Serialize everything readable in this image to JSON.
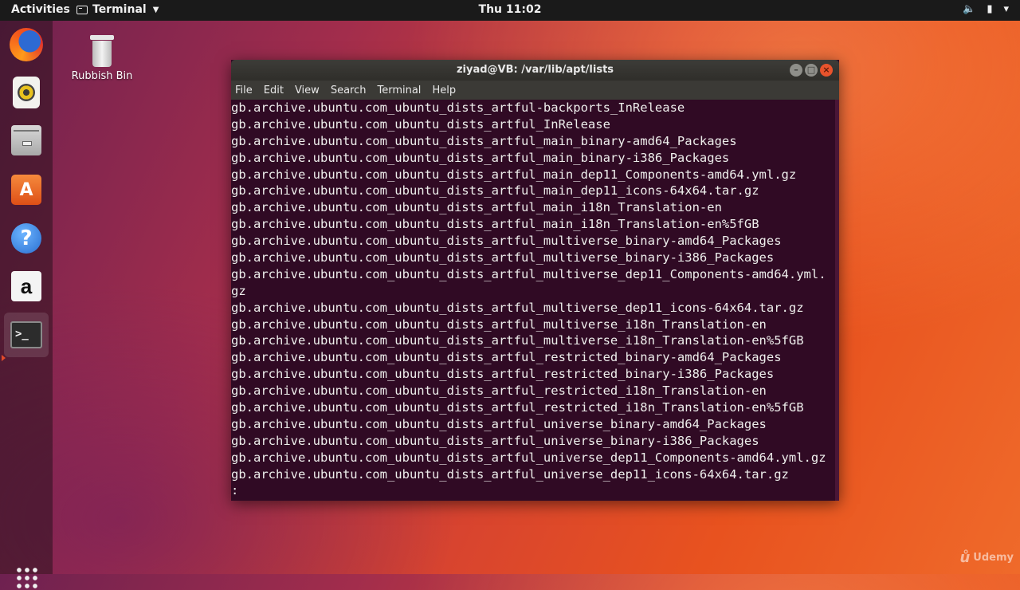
{
  "topbar": {
    "activities": "Activities",
    "app_name": "Terminal",
    "clock": "Thu 11:02"
  },
  "launcher": {
    "items": [
      "firefox",
      "rhythmbox",
      "files",
      "ubuntu-software",
      "help",
      "amazon",
      "terminal"
    ]
  },
  "desktop": {
    "trash_label": "Rubbish Bin"
  },
  "window": {
    "title": "ziyad@VB: /var/lib/apt/lists",
    "menu": [
      "File",
      "Edit",
      "View",
      "Search",
      "Terminal",
      "Help"
    ],
    "lines": [
      "gb.archive.ubuntu.com_ubuntu_dists_artful-backports_InRelease",
      "gb.archive.ubuntu.com_ubuntu_dists_artful_InRelease",
      "gb.archive.ubuntu.com_ubuntu_dists_artful_main_binary-amd64_Packages",
      "gb.archive.ubuntu.com_ubuntu_dists_artful_main_binary-i386_Packages",
      "gb.archive.ubuntu.com_ubuntu_dists_artful_main_dep11_Components-amd64.yml.gz",
      "gb.archive.ubuntu.com_ubuntu_dists_artful_main_dep11_icons-64x64.tar.gz",
      "gb.archive.ubuntu.com_ubuntu_dists_artful_main_i18n_Translation-en",
      "gb.archive.ubuntu.com_ubuntu_dists_artful_main_i18n_Translation-en%5fGB",
      "gb.archive.ubuntu.com_ubuntu_dists_artful_multiverse_binary-amd64_Packages",
      "gb.archive.ubuntu.com_ubuntu_dists_artful_multiverse_binary-i386_Packages",
      "gb.archive.ubuntu.com_ubuntu_dists_artful_multiverse_dep11_Components-amd64.yml.",
      "gz",
      "gb.archive.ubuntu.com_ubuntu_dists_artful_multiverse_dep11_icons-64x64.tar.gz",
      "gb.archive.ubuntu.com_ubuntu_dists_artful_multiverse_i18n_Translation-en",
      "gb.archive.ubuntu.com_ubuntu_dists_artful_multiverse_i18n_Translation-en%5fGB",
      "gb.archive.ubuntu.com_ubuntu_dists_artful_restricted_binary-amd64_Packages",
      "gb.archive.ubuntu.com_ubuntu_dists_artful_restricted_binary-i386_Packages",
      "gb.archive.ubuntu.com_ubuntu_dists_artful_restricted_i18n_Translation-en",
      "gb.archive.ubuntu.com_ubuntu_dists_artful_restricted_i18n_Translation-en%5fGB",
      "gb.archive.ubuntu.com_ubuntu_dists_artful_universe_binary-amd64_Packages",
      "gb.archive.ubuntu.com_ubuntu_dists_artful_universe_binary-i386_Packages",
      "gb.archive.ubuntu.com_ubuntu_dists_artful_universe_dep11_Components-amd64.yml.gz",
      "gb.archive.ubuntu.com_ubuntu_dists_artful_universe_dep11_icons-64x64.tar.gz",
      ":"
    ]
  },
  "watermark": {
    "text": "Udemy"
  },
  "colors": {
    "terminal_bg": "#300a24",
    "terminal_fg": "#eeeeec",
    "close_button": "#e8532c"
  }
}
